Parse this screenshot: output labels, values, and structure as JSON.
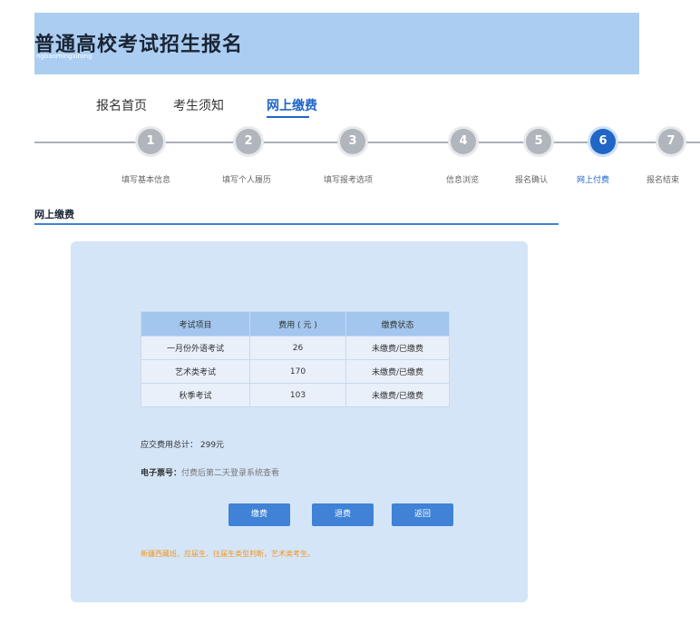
{
  "header": {
    "title": "普通高校考试招生报名",
    "subtitle": "ngbaomingxitong"
  },
  "nav": [
    {
      "label": "报名首页"
    },
    {
      "label": "考生须知"
    },
    {
      "label": "网上缴费",
      "active": true
    }
  ],
  "steps": [
    {
      "number": "1",
      "label": "填写基本信息"
    },
    {
      "number": "2",
      "label": "填写个人履历"
    },
    {
      "number": "3",
      "label": "填写报考选项"
    },
    {
      "number": "4",
      "label": "信息浏览"
    },
    {
      "number": "5",
      "label": "报名确认"
    },
    {
      "number": "6",
      "label": "网上付费",
      "active": true
    },
    {
      "number": "7",
      "label": "报名结束"
    }
  ],
  "section": {
    "title": "网上缴费"
  },
  "fee_table": {
    "headers": [
      "考试项目",
      "费用 ( 元 )",
      "缴费状态"
    ],
    "rows": [
      [
        "一月份外语考试",
        "26",
        "未缴费/已缴费"
      ],
      [
        "艺术类考试",
        "170",
        "未缴费/已缴费"
      ],
      [
        "秋季考试",
        "103",
        "未缴费/已缴费"
      ]
    ]
  },
  "summary": {
    "total": "应交费用总计： 299元",
    "ticket_label": "电子票号：",
    "ticket_value": "付费后第二天登录系统查看"
  },
  "buttons": {
    "pay": "缴费",
    "refund": "退费",
    "back": "返回"
  },
  "note": "新疆西藏班、应届生、往届生类型判断，艺术类考生。",
  "colors": {
    "header_bg": "#abcdf1",
    "accent": "#1f66c7",
    "button": "#3f82d6",
    "panel_bg": "#d5e5f8",
    "note": "#f0971e"
  }
}
